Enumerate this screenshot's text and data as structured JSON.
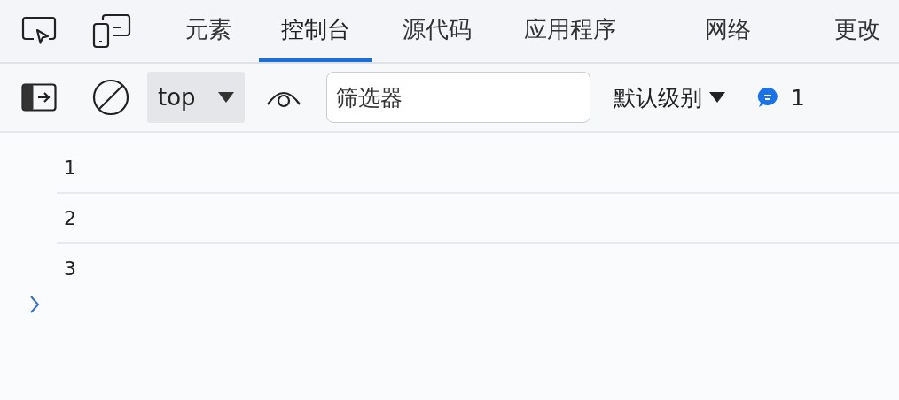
{
  "tabs": [
    {
      "label": "元素",
      "selected": false
    },
    {
      "label": "控制台",
      "selected": true
    },
    {
      "label": "源代码",
      "selected": false
    },
    {
      "label": "应用程序",
      "selected": false
    },
    {
      "label": "网络",
      "selected": false
    },
    {
      "label": "更改",
      "selected": false
    }
  ],
  "toolbar": {
    "context": "top",
    "filter": {
      "placeholder": "筛选器"
    },
    "level": "默认级别",
    "message_count": "1"
  },
  "console": {
    "lines": [
      "1",
      "2",
      "3"
    ]
  }
}
